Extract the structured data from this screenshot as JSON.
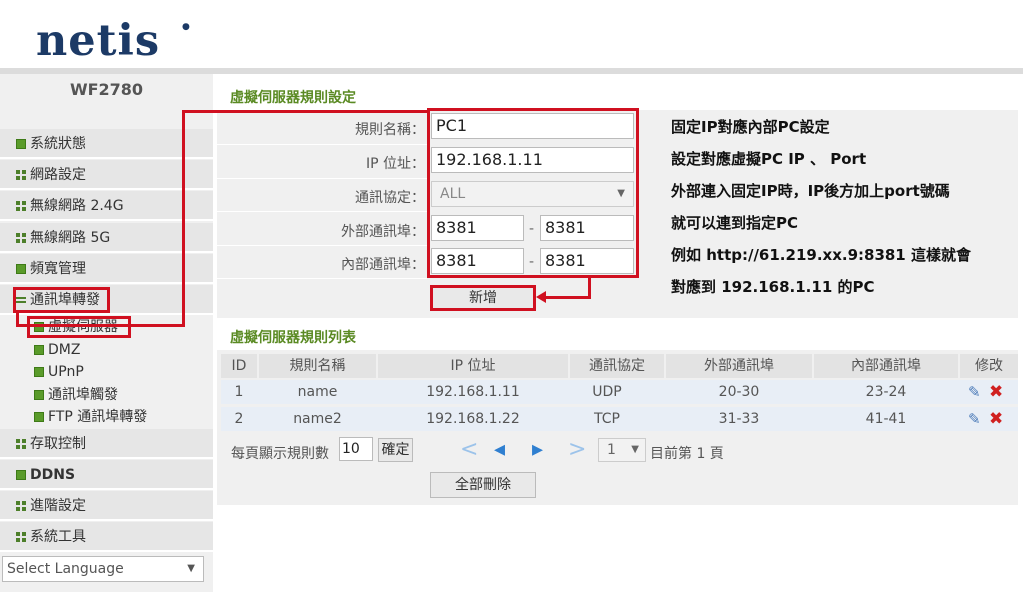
{
  "brand": {
    "logo": "netis"
  },
  "sidebar": {
    "model": "WF2780",
    "items": [
      {
        "label": "系統狀態"
      },
      {
        "label": "網路設定"
      },
      {
        "label": "無線網路 2.4G"
      },
      {
        "label": "無線網路 5G"
      },
      {
        "label": "頻寬管理"
      },
      {
        "label": "通訊埠轉發"
      },
      {
        "label": "存取控制"
      },
      {
        "label": "DDNS"
      },
      {
        "label": "進階設定"
      },
      {
        "label": "系統工具"
      }
    ],
    "subitems": [
      {
        "label": "虛擬伺服器"
      },
      {
        "label": "DMZ"
      },
      {
        "label": "UPnP"
      },
      {
        "label": "通訊埠觸發"
      },
      {
        "label": "FTP 通訊埠轉發"
      }
    ],
    "language": "Select Language"
  },
  "form": {
    "title": "虛擬伺服器規則設定",
    "rule_name_label": "規則名稱：",
    "rule_name_value": "PC1",
    "ip_label": "IP 位址：",
    "ip_value": "192.168.1.11",
    "protocol_label": "通訊協定：",
    "protocol_value": "ALL",
    "ext_port_label": "外部通訊埠：",
    "ext_port_start": "8381",
    "ext_port_end": "8381",
    "int_port_label": "內部通訊埠：",
    "int_port_start": "8381",
    "int_port_end": "8381",
    "dash": "-",
    "add_button": "新增"
  },
  "annotations": [
    "固定IP對應內部PC設定",
    "設定對應虛擬PC  IP  、 Port",
    "外部連入固定IP時，IP後方加上port號碼",
    "就可以連到指定PC",
    "例如 http://61.219.xx.9:8381 這樣就會",
    "對應到 192.168.1.11 的PC"
  ],
  "list": {
    "title": "虛擬伺服器規則列表",
    "headers": [
      "ID",
      "規則名稱",
      "IP 位址",
      "通訊協定",
      "外部通訊埠",
      "內部通訊埠",
      "修改"
    ],
    "rows": [
      [
        "1",
        "name",
        "192.168.1.11",
        "UDP",
        "20-30",
        "23-24"
      ],
      [
        "2",
        "name2",
        "192.168.1.22",
        "TCP",
        "31-33",
        "41-41"
      ]
    ],
    "per_page_label": "每頁顯示規則數",
    "per_page_value": "10",
    "confirm_button": "確定",
    "page_select": "1",
    "page_status": "目前第 1 頁",
    "delete_all_button": "全部刪除"
  },
  "colors": {
    "accent_red": "#d01020",
    "title_green": "#5a8a23",
    "brand_navy": "#1c3a66"
  }
}
